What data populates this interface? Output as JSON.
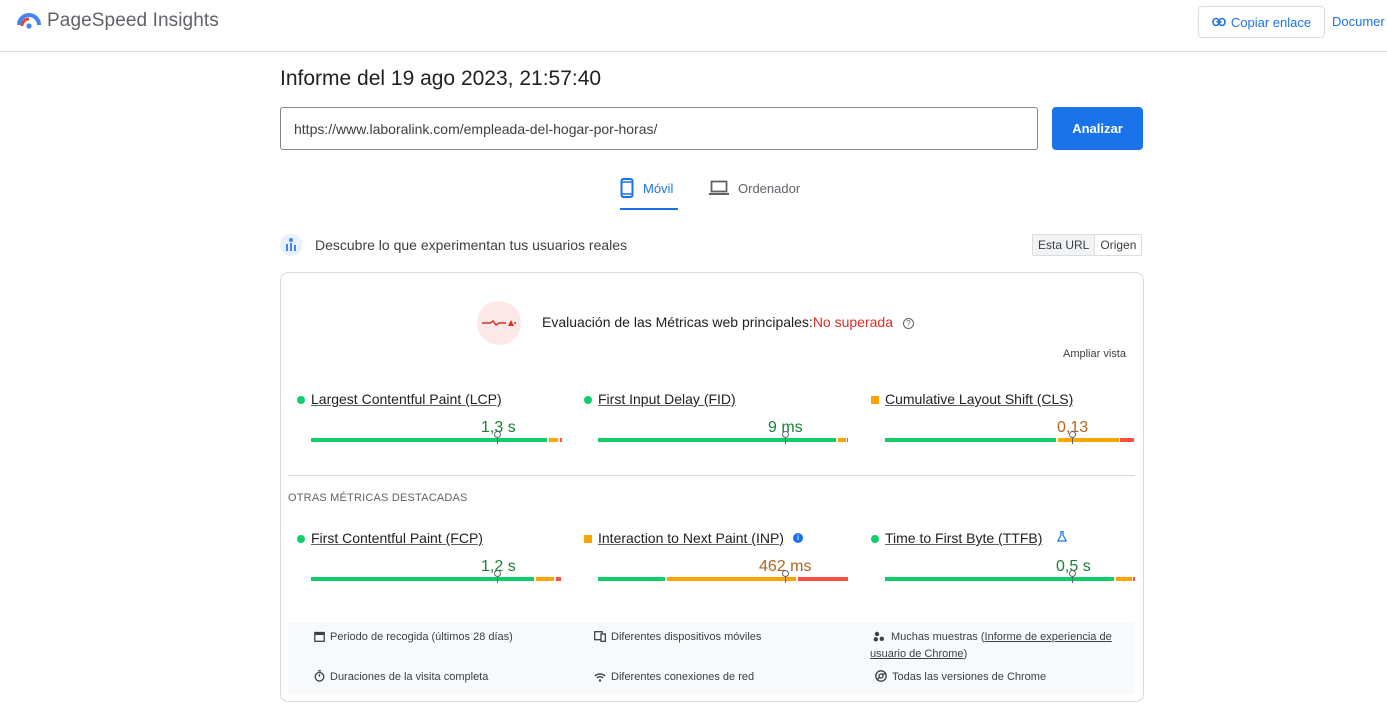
{
  "header": {
    "brand": "PageSpeed Insights",
    "copy_link_label": "Copiar enlace",
    "docs_label": "Documer"
  },
  "report_title": "Informe del 19 ago 2023, 21:57:40",
  "search": {
    "url_value": "https://www.laboralink.com/empleada-del-hogar-por-horas/",
    "analyze_label": "Analizar"
  },
  "tabs": [
    {
      "label": "Móvil",
      "selected": true
    },
    {
      "label": "Ordenador",
      "selected": false
    }
  ],
  "field_data": {
    "heading": "Descubre lo que experimentan tus usuarios reales",
    "toggle": [
      "Esta URL",
      "Origen"
    ],
    "assessment_prefix": "Evaluación de las Métricas web principales:",
    "assessment_result": "No superada",
    "expand_label": "Ampliar vista",
    "core_metrics": [
      {
        "name": "Largest Contentful Paint (LCP)",
        "value": "1,3 s",
        "rating": "good",
        "distribution": [
          0.95,
          0.04,
          0.01
        ]
      },
      {
        "name": "First Input Delay (FID)",
        "value": "9 ms",
        "rating": "good",
        "distribution": [
          0.96,
          0.03,
          0.01
        ]
      },
      {
        "name": "Cumulative Layout Shift (CLS)",
        "value": "0,13",
        "rating": "average",
        "distribution": [
          0.69,
          0.25,
          0.06
        ]
      }
    ],
    "other_title": "OTRAS MÉTRICAS DESTACADAS",
    "other_metrics": [
      {
        "name": "First Contentful Paint (FCP)",
        "value": "1,2 s",
        "rating": "good",
        "distribution": [
          0.9,
          0.08,
          0.02
        ]
      },
      {
        "name": "Interaction to Next Paint (INP)",
        "value": "462 ms",
        "rating": "average",
        "distribution": [
          0.27,
          0.53,
          0.2
        ]
      },
      {
        "name": "Time to First Byte (TTFB)",
        "value": "0,5 s",
        "rating": "good",
        "distribution": [
          0.92,
          0.07,
          0.01
        ]
      }
    ],
    "footer": {
      "period": "Periodo de recogida (últimos 28 días)",
      "devices": "Diferentes dispositivos móviles",
      "samples_prefix": "Muchas muestras (",
      "samples_link": "Informe de experiencia de usuario de Chrome",
      "samples_suffix": ")",
      "durations": "Duraciones de la visita completa",
      "connections": "Diferentes conexiones de red",
      "versions": "Todas las versiones de Chrome"
    }
  },
  "colors": {
    "accent": "#1a73e8",
    "good": "#0cce6b",
    "average": "#ffa400",
    "poor": "#ff4e42",
    "fail_text": "#d93025"
  }
}
